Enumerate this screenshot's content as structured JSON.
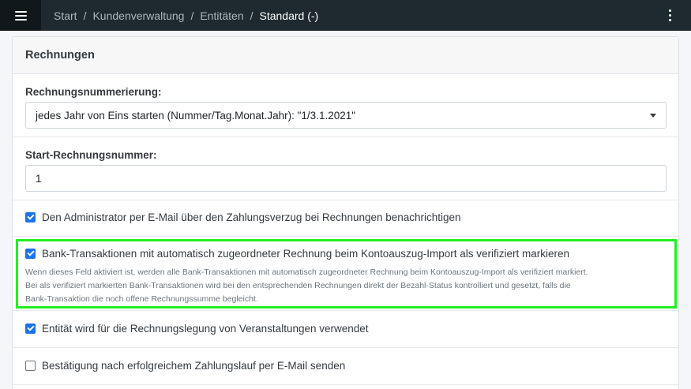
{
  "topbar": {
    "breadcrumbs": [
      "Start",
      "Kundenverwaltung",
      "Entitäten",
      "Standard (-)"
    ]
  },
  "card": {
    "title": "Rechnungen",
    "numbering": {
      "label": "Rechnungsnummerierung:",
      "selected": "jedes Jahr von Eins starten (Nummer/Tag.Monat.Jahr): \"1/3.1.2021\""
    },
    "start_number": {
      "label": "Start-Rechnungsnummer:",
      "value": "1"
    },
    "checkboxes": [
      {
        "label": "Den Administrator per E-Mail über den Zahlungsverzug bei Rechnungen benachrichtigen",
        "checked": true
      },
      {
        "label": "Bank-Transaktionen mit automatisch zugeordneter Rechnung beim Kontoauszug-Import als verifiziert markieren",
        "checked": true
      },
      {
        "label": "Entität wird für die Rechnungslegung von Veranstaltungen verwendet",
        "checked": true
      },
      {
        "label": "Bestätigung nach erfolgreichem Zahlungslauf per E-Mail senden",
        "checked": false
      }
    ],
    "help_lines": [
      "Wenn dieses Feld aktiviert ist, werden alle Bank-Transaktionen mit automatisch zugeordneter Rechnung beim Kontoauszug-Import als verifiziert markiert.",
      "Bei als verifiziert markierten Bank-Transaktionen wird bei den entsprechenden Rechnungen direkt der Bezahl-Status kontrolliert und gesetzt, falls die",
      "Bank-Transaktion die noch offene Rechnungssumme begleicht."
    ]
  }
}
